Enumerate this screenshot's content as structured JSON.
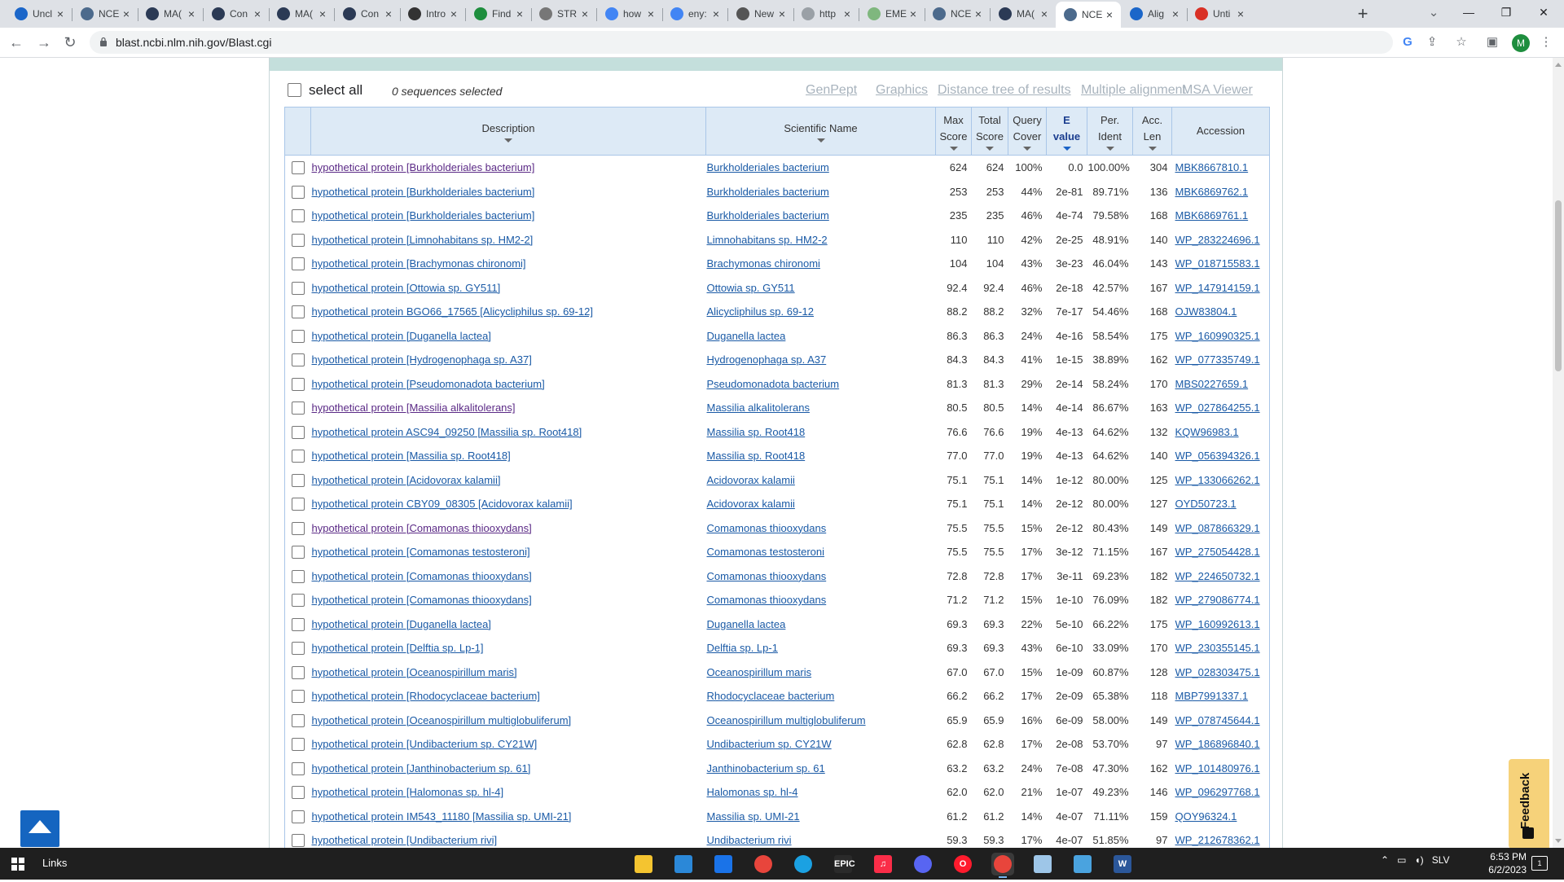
{
  "browser": {
    "tabs": [
      {
        "title": "Uncl",
        "icon": "ncbi-icon",
        "color": "#1b66c9"
      },
      {
        "title": "NCE",
        "icon": "ncbi-icon",
        "color": "#4c6a8c"
      },
      {
        "title": "MA(",
        "icon": "mac-icon",
        "color": "#2b3a55"
      },
      {
        "title": "Con",
        "icon": "mac-icon",
        "color": "#2b3a55"
      },
      {
        "title": "MA(",
        "icon": "mac-icon",
        "color": "#2b3a55"
      },
      {
        "title": "Con",
        "icon": "mac-icon",
        "color": "#2b3a55"
      },
      {
        "title": "Intro",
        "icon": "doc-icon",
        "color": "#333333"
      },
      {
        "title": "Find",
        "icon": "find-icon",
        "color": "#1e8e3e"
      },
      {
        "title": "STR",
        "icon": "string-icon",
        "color": "#777777"
      },
      {
        "title": "how",
        "icon": "google-icon",
        "color": "#4285f4"
      },
      {
        "title": "eny:",
        "icon": "google-icon",
        "color": "#4285f4"
      },
      {
        "title": "New",
        "icon": "web-icon",
        "color": "#555555"
      },
      {
        "title": "http",
        "icon": "web-icon",
        "color": "#9aa0a6"
      },
      {
        "title": "EME",
        "icon": "web-icon",
        "color": "#7fb77e"
      },
      {
        "title": "NCE",
        "icon": "ncbi-icon",
        "color": "#4c6a8c"
      },
      {
        "title": "MA(",
        "icon": "mac-icon",
        "color": "#2b3a55"
      },
      {
        "title": "NCE",
        "icon": "ncbi-icon",
        "color": "#4c6a8c",
        "active": true
      },
      {
        "title": "Alig",
        "icon": "ncbi-icon",
        "color": "#1b66c9"
      },
      {
        "title": "Unti",
        "icon": "doc-icon",
        "color": "#d93025"
      }
    ],
    "url": "blast.ncbi.nlm.nih.gov/Blast.cgi"
  },
  "controls": {
    "select_all": "select all",
    "selected_count": "0 sequences selected",
    "links": [
      "GenPept",
      "Graphics",
      "Distance tree of results",
      "Multiple alignment",
      "MSA Viewer"
    ]
  },
  "table": {
    "headers": {
      "description": "Description",
      "sci_name": "Scientific Name",
      "max_score": [
        "Max",
        "Score"
      ],
      "total_score": [
        "Total",
        "Score"
      ],
      "query_cover": [
        "Query",
        "Cover"
      ],
      "evalue": [
        "E",
        "value"
      ],
      "per_ident": [
        "Per.",
        "Ident"
      ],
      "acc_len": [
        "Acc.",
        "Len"
      ],
      "accession": "Accession"
    },
    "rows": [
      {
        "desc": "hypothetical protein [Burkholderiales bacterium]",
        "sci": "Burkholderiales bacterium",
        "max": "624",
        "total": "624",
        "cover": "100%",
        "evalue": "0.0",
        "ident": "100.00%",
        "len": "304",
        "acc": "MBK8667810.1",
        "visited": true
      },
      {
        "desc": "hypothetical protein [Burkholderiales bacterium]",
        "sci": "Burkholderiales bacterium",
        "max": "253",
        "total": "253",
        "cover": "44%",
        "evalue": "2e-81",
        "ident": "89.71%",
        "len": "136",
        "acc": "MBK6869762.1"
      },
      {
        "desc": "hypothetical protein [Burkholderiales bacterium]",
        "sci": "Burkholderiales bacterium",
        "max": "235",
        "total": "235",
        "cover": "46%",
        "evalue": "4e-74",
        "ident": "79.58%",
        "len": "168",
        "acc": "MBK6869761.1"
      },
      {
        "desc": "hypothetical protein [Limnohabitans sp. HM2-2]",
        "sci": "Limnohabitans sp. HM2-2",
        "max": "110",
        "total": "110",
        "cover": "42%",
        "evalue": "2e-25",
        "ident": "48.91%",
        "len": "140",
        "acc": "WP_283224696.1"
      },
      {
        "desc": "hypothetical protein [Brachymonas chironomi]",
        "sci": "Brachymonas chironomi",
        "max": "104",
        "total": "104",
        "cover": "43%",
        "evalue": "3e-23",
        "ident": "46.04%",
        "len": "143",
        "acc": "WP_018715583.1"
      },
      {
        "desc": "hypothetical protein [Ottowia sp. GY511]",
        "sci": "Ottowia sp. GY511",
        "max": "92.4",
        "total": "92.4",
        "cover": "46%",
        "evalue": "2e-18",
        "ident": "42.57%",
        "len": "167",
        "acc": "WP_147914159.1"
      },
      {
        "desc": "hypothetical protein BGO66_17565 [Alicycliphilus sp. 69-12]",
        "sci": "Alicycliphilus sp. 69-12",
        "max": "88.2",
        "total": "88.2",
        "cover": "32%",
        "evalue": "7e-17",
        "ident": "54.46%",
        "len": "168",
        "acc": "OJW83804.1"
      },
      {
        "desc": "hypothetical protein [Duganella lactea]",
        "sci": "Duganella lactea",
        "max": "86.3",
        "total": "86.3",
        "cover": "24%",
        "evalue": "4e-16",
        "ident": "58.54%",
        "len": "175",
        "acc": "WP_160990325.1"
      },
      {
        "desc": "hypothetical protein [Hydrogenophaga sp. A37]",
        "sci": "Hydrogenophaga sp. A37",
        "max": "84.3",
        "total": "84.3",
        "cover": "41%",
        "evalue": "1e-15",
        "ident": "38.89%",
        "len": "162",
        "acc": "WP_077335749.1"
      },
      {
        "desc": "hypothetical protein [Pseudomonadota bacterium]",
        "sci": "Pseudomonadota bacterium",
        "max": "81.3",
        "total": "81.3",
        "cover": "29%",
        "evalue": "2e-14",
        "ident": "58.24%",
        "len": "170",
        "acc": "MBS0227659.1"
      },
      {
        "desc": "hypothetical protein [Massilia alkalitolerans]",
        "sci": "Massilia alkalitolerans",
        "max": "80.5",
        "total": "80.5",
        "cover": "14%",
        "evalue": "4e-14",
        "ident": "86.67%",
        "len": "163",
        "acc": "WP_027864255.1",
        "visited": true
      },
      {
        "desc": "hypothetical protein ASC94_09250 [Massilia sp. Root418]",
        "sci": "Massilia sp. Root418",
        "max": "76.6",
        "total": "76.6",
        "cover": "19%",
        "evalue": "4e-13",
        "ident": "64.62%",
        "len": "132",
        "acc": "KQW96983.1"
      },
      {
        "desc": "hypothetical protein [Massilia sp. Root418]",
        "sci": "Massilia sp. Root418",
        "max": "77.0",
        "total": "77.0",
        "cover": "19%",
        "evalue": "4e-13",
        "ident": "64.62%",
        "len": "140",
        "acc": "WP_056394326.1"
      },
      {
        "desc": "hypothetical protein [Acidovorax kalamii]",
        "sci": "Acidovorax kalamii",
        "max": "75.1",
        "total": "75.1",
        "cover": "14%",
        "evalue": "1e-12",
        "ident": "80.00%",
        "len": "125",
        "acc": "WP_133066262.1"
      },
      {
        "desc": "hypothetical protein CBY09_08305 [Acidovorax kalamii]",
        "sci": "Acidovorax kalamii",
        "max": "75.1",
        "total": "75.1",
        "cover": "14%",
        "evalue": "2e-12",
        "ident": "80.00%",
        "len": "127",
        "acc": "OYD50723.1"
      },
      {
        "desc": "hypothetical protein [Comamonas thiooxydans]",
        "sci": "Comamonas thiooxydans",
        "max": "75.5",
        "total": "75.5",
        "cover": "15%",
        "evalue": "2e-12",
        "ident": "80.43%",
        "len": "149",
        "acc": "WP_087866329.1",
        "visited": true
      },
      {
        "desc": "hypothetical protein [Comamonas testosteroni]",
        "sci": "Comamonas testosteroni",
        "max": "75.5",
        "total": "75.5",
        "cover": "17%",
        "evalue": "3e-12",
        "ident": "71.15%",
        "len": "167",
        "acc": "WP_275054428.1"
      },
      {
        "desc": "hypothetical protein [Comamonas thiooxydans]",
        "sci": "Comamonas thiooxydans",
        "max": "72.8",
        "total": "72.8",
        "cover": "17%",
        "evalue": "3e-11",
        "ident": "69.23%",
        "len": "182",
        "acc": "WP_224650732.1"
      },
      {
        "desc": "hypothetical protein [Comamonas thiooxydans]",
        "sci": "Comamonas thiooxydans",
        "max": "71.2",
        "total": "71.2",
        "cover": "15%",
        "evalue": "1e-10",
        "ident": "76.09%",
        "len": "182",
        "acc": "WP_279086774.1"
      },
      {
        "desc": "hypothetical protein [Duganella lactea]",
        "sci": "Duganella lactea",
        "max": "69.3",
        "total": "69.3",
        "cover": "22%",
        "evalue": "5e-10",
        "ident": "66.22%",
        "len": "175",
        "acc": "WP_160992613.1"
      },
      {
        "desc": "hypothetical protein [Delftia sp. Lp-1]",
        "sci": "Delftia sp. Lp-1",
        "max": "69.3",
        "total": "69.3",
        "cover": "43%",
        "evalue": "6e-10",
        "ident": "33.09%",
        "len": "170",
        "acc": "WP_230355145.1"
      },
      {
        "desc": "hypothetical protein [Oceanospirillum maris]",
        "sci": "Oceanospirillum maris",
        "max": "67.0",
        "total": "67.0",
        "cover": "15%",
        "evalue": "1e-09",
        "ident": "60.87%",
        "len": "128",
        "acc": "WP_028303475.1"
      },
      {
        "desc": "hypothetical protein [Rhodocyclaceae bacterium]",
        "sci": "Rhodocyclaceae bacterium",
        "max": "66.2",
        "total": "66.2",
        "cover": "17%",
        "evalue": "2e-09",
        "ident": "65.38%",
        "len": "118",
        "acc": "MBP7991337.1"
      },
      {
        "desc": "hypothetical protein [Oceanospirillum multiglobuliferum]",
        "sci": "Oceanospirillum multiglobuliferum",
        "max": "65.9",
        "total": "65.9",
        "cover": "16%",
        "evalue": "6e-09",
        "ident": "58.00%",
        "len": "149",
        "acc": "WP_078745644.1"
      },
      {
        "desc": "hypothetical protein [Undibacterium sp. CY21W]",
        "sci": "Undibacterium sp. CY21W",
        "max": "62.8",
        "total": "62.8",
        "cover": "17%",
        "evalue": "2e-08",
        "ident": "53.70%",
        "len": "97",
        "acc": "WP_186896840.1"
      },
      {
        "desc": "hypothetical protein [Janthinobacterium sp. 61]",
        "sci": "Janthinobacterium sp. 61",
        "max": "63.2",
        "total": "63.2",
        "cover": "24%",
        "evalue": "7e-08",
        "ident": "47.30%",
        "len": "162",
        "acc": "WP_101480976.1"
      },
      {
        "desc": "hypothetical protein [Halomonas sp. hl-4]",
        "sci": "Halomonas sp. hl-4",
        "max": "62.0",
        "total": "62.0",
        "cover": "21%",
        "evalue": "1e-07",
        "ident": "49.23%",
        "len": "146",
        "acc": "WP_096297768.1"
      },
      {
        "desc": "hypothetical protein IM543_11180 [Massilia sp. UMI-21]",
        "sci": "Massilia sp. UMI-21",
        "max": "61.2",
        "total": "61.2",
        "cover": "14%",
        "evalue": "4e-07",
        "ident": "71.11%",
        "len": "159",
        "acc": "QOY96324.1"
      },
      {
        "desc": "hypothetical protein [Undibacterium rivi]",
        "sci": "Undibacterium rivi",
        "max": "59.3",
        "total": "59.3",
        "cover": "17%",
        "evalue": "4e-07",
        "ident": "51.85%",
        "len": "97",
        "acc": "WP_212678362.1"
      }
    ]
  },
  "widgets": {
    "feedback": "Feedback"
  },
  "taskbar": {
    "links": "Links",
    "tray_lang": "SLV",
    "time": "6:53 PM",
    "date": "6/2/2023",
    "notification_count": "1",
    "apps": [
      {
        "name": "file-explorer-icon",
        "color": "#f4c430",
        "glyph": ""
      },
      {
        "name": "store-icon",
        "color": "#2b88d8",
        "glyph": ""
      },
      {
        "name": "mail-icon",
        "color": "#1a73e8",
        "glyph": ""
      },
      {
        "name": "chrome-icon",
        "color": "#e8453c",
        "glyph": ""
      },
      {
        "name": "edge-icon",
        "color": "#1ba1e2",
        "glyph": ""
      },
      {
        "name": "epic-games-icon",
        "color": "#2a2a2a",
        "glyph": "EPIC"
      },
      {
        "name": "music-icon",
        "color": "#fa2d48",
        "glyph": "♫"
      },
      {
        "name": "discord-icon",
        "color": "#5865f2",
        "glyph": ""
      },
      {
        "name": "opera-icon",
        "color": "#ff1b2d",
        "glyph": "O"
      },
      {
        "name": "chrome-profile-icon",
        "color": "#e8453c",
        "glyph": "",
        "active": true
      },
      {
        "name": "notepad-icon",
        "color": "#9ec6e8",
        "glyph": ""
      },
      {
        "name": "photos-icon",
        "color": "#4aa3df",
        "glyph": ""
      },
      {
        "name": "word-icon",
        "color": "#2b579a",
        "glyph": "W"
      }
    ]
  }
}
